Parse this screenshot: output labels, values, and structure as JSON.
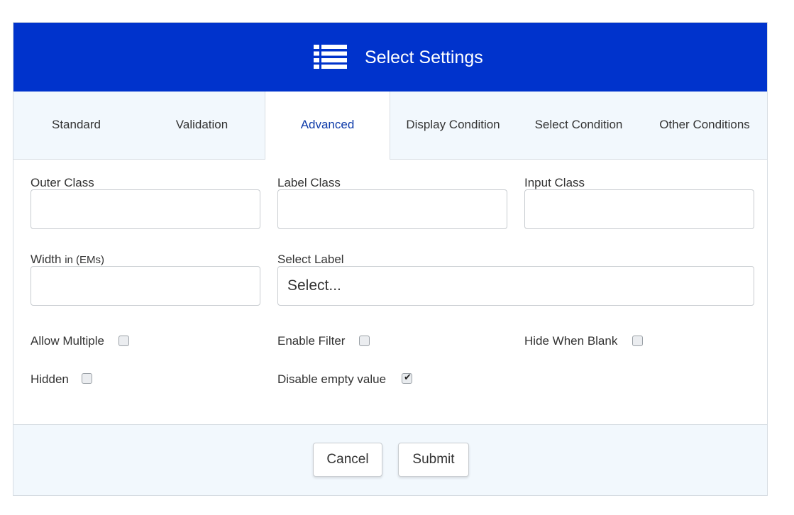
{
  "header": {
    "title": "Select Settings",
    "icon": "list-icon",
    "background": "#0033cc"
  },
  "tabs": [
    {
      "label": "Standard"
    },
    {
      "label": "Validation"
    },
    {
      "label": "Advanced"
    },
    {
      "label": "Display Condition"
    },
    {
      "label": "Select Condition"
    },
    {
      "label": "Other Conditions"
    }
  ],
  "active_tab": "Advanced",
  "fields": {
    "outer_class": {
      "label": "Outer Class",
      "value": ""
    },
    "label_class": {
      "label": "Label Class",
      "value": ""
    },
    "input_class": {
      "label": "Input Class",
      "value": ""
    },
    "width": {
      "label": "Width",
      "unit": "in (EMs)",
      "value": ""
    },
    "select_label": {
      "label": "Select Label",
      "value": "Select..."
    }
  },
  "options": {
    "allow_multiple": {
      "label": "Allow Multiple",
      "checked": false
    },
    "enable_filter": {
      "label": "Enable Filter",
      "checked": false
    },
    "hide_when_blank": {
      "label": "Hide When Blank",
      "checked": false
    },
    "hidden": {
      "label": "Hidden",
      "checked": false
    },
    "disable_empty_value": {
      "label": "Disable empty value",
      "checked": true
    }
  },
  "footer": {
    "cancel_label": "Cancel",
    "submit_label": "Submit"
  }
}
